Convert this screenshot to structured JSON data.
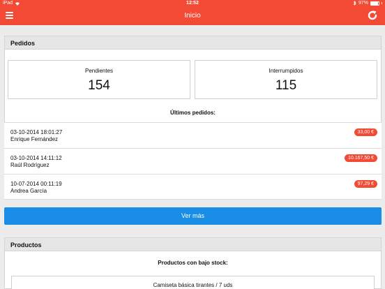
{
  "status_bar": {
    "device": "iPad",
    "time": "12:52",
    "battery": "97%"
  },
  "nav": {
    "title": "Inicio"
  },
  "orders": {
    "header": "Pedidos",
    "pending": {
      "label": "Pendientes",
      "value": "154"
    },
    "interrupted": {
      "label": "Interrumpidos",
      "value": "115"
    },
    "latest_title": "Últimos pedidos:",
    "items": [
      {
        "date": "03-10-2014 18:01:27",
        "name": "Enrique Fernández",
        "amount": "33,00 €"
      },
      {
        "date": "03-10-2014 14:11:12",
        "name": "Raúl Rodríguez",
        "amount": "10.167,50 €"
      },
      {
        "date": "10-07-2014 00:11:19",
        "name": "Andrea García",
        "amount": "97,29 €"
      }
    ],
    "more_button": "Ver más"
  },
  "products": {
    "header": "Productos",
    "low_stock_title": "Productos con bajo stock:",
    "items": [
      {
        "label": "Camiseta básica tirantes / 7 uds"
      }
    ]
  },
  "colors": {
    "accent": "#f34a36",
    "button": "#1a8de6"
  }
}
